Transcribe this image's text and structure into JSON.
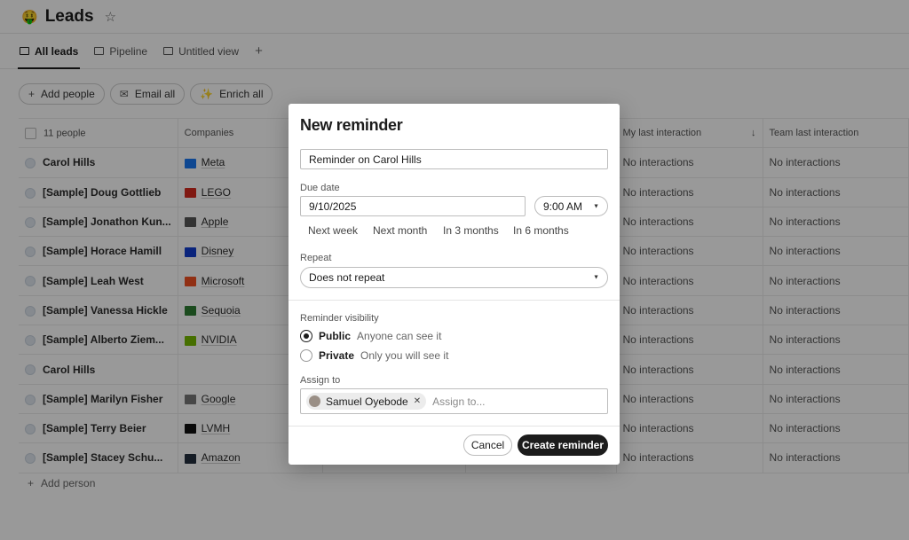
{
  "page": {
    "title": "Leads",
    "emoji": "🤑"
  },
  "tabs": [
    {
      "label": "All leads"
    },
    {
      "label": "Pipeline"
    },
    {
      "label": "Untitled view"
    }
  ],
  "actions": [
    {
      "label": "Add people",
      "icon": "+"
    },
    {
      "label": "Email all",
      "icon": "✉"
    },
    {
      "label": "Enrich all",
      "icon": "✨"
    }
  ],
  "table": {
    "headers": [
      "11 people",
      "Companies",
      "",
      "",
      "My last interaction",
      "Team last interaction"
    ],
    "rows": [
      {
        "name": "Carol Hills",
        "company": "Meta",
        "logo_color": "#1877f2",
        "my": "No interactions",
        "team": "No interactions"
      },
      {
        "name": "[Sample] Doug Gottlieb",
        "company": "LEGO",
        "logo_color": "#d52b1e",
        "my": "No interactions",
        "team": "No interactions"
      },
      {
        "name": "[Sample] Jonathon Kun...",
        "company": "Apple",
        "logo_color": "#555555",
        "my": "No interactions",
        "team": "No interactions"
      },
      {
        "name": "[Sample] Horace Hamill",
        "company": "Disney",
        "logo_color": "#113ccf",
        "my": "No interactions",
        "team": "No interactions"
      },
      {
        "name": "[Sample] Leah West",
        "company": "Microsoft",
        "logo_color": "#f25022",
        "my": "No interactions",
        "team": "No interactions"
      },
      {
        "name": "[Sample] Vanessa Hickle",
        "company": "Sequoia",
        "logo_color": "#2e7d32",
        "my": "No interactions",
        "team": "No interactions"
      },
      {
        "name": "[Sample] Alberto Ziem...",
        "company": "NVIDIA",
        "logo_color": "#76b900",
        "my": "No interactions",
        "team": "No interactions"
      },
      {
        "name": "Carol Hills",
        "company": "",
        "logo_color": "",
        "my": "No interactions",
        "team": "No interactions"
      },
      {
        "name": "[Sample] Marilyn Fisher",
        "company": "Google",
        "logo_color": "#777777",
        "my": "No interactions",
        "team": "No interactions"
      },
      {
        "name": "[Sample] Terry Beier",
        "company": "LVMH",
        "logo_color": "#111111",
        "my": "No interactions",
        "team": "No interactions"
      },
      {
        "name": "[Sample] Stacey Schu...",
        "company": "Amazon",
        "logo_color": "#232f3e",
        "my": "No interactions",
        "team": "No interactions"
      }
    ],
    "add_person": "Add person"
  },
  "modal": {
    "title": "New reminder",
    "reminder_text": "Reminder on Carol Hills",
    "due_date_label": "Due date",
    "due_date": "9/10/2025",
    "time": "9:00 AM",
    "quick_dates": [
      "Next week",
      "Next month",
      "In 3 months",
      "In 6 months"
    ],
    "repeat_label": "Repeat",
    "repeat_value": "Does not repeat",
    "visibility_label": "Reminder visibility",
    "visibility": [
      {
        "label": "Public",
        "desc": "Anyone can see it",
        "selected": true
      },
      {
        "label": "Private",
        "desc": "Only you will see it",
        "selected": false
      }
    ],
    "assign_label": "Assign to",
    "assignee": "Samuel Oyebode",
    "assign_placeholder": "Assign to...",
    "cancel_label": "Cancel",
    "create_label": "Create reminder"
  }
}
